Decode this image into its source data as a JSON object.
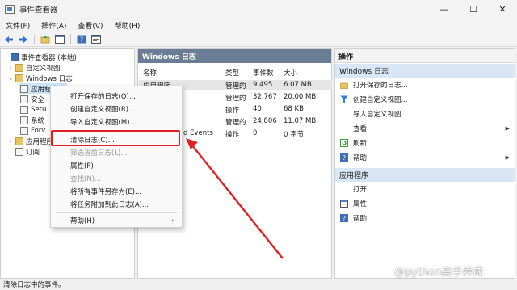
{
  "window": {
    "title": "事件查看器",
    "buttons": {
      "minimize": "—",
      "maximize": "☐",
      "close": "✕"
    }
  },
  "menubar": [
    "文件(F)",
    "操作(A)",
    "查看(V)",
    "帮助(H)"
  ],
  "tree": {
    "root": "事件查看器 (本地)",
    "custom_views": "自定义视图",
    "windows_logs": "Windows 日志",
    "children": [
      "应用程序",
      "安全",
      "Setu",
      "系统",
      "Forv"
    ],
    "app_service_logs": "应用程序",
    "subscriptions": "订阅"
  },
  "center": {
    "title": "Windows 日志",
    "columns": [
      "名称",
      "类型",
      "事件数",
      "大小"
    ],
    "rows": [
      {
        "name": "应用程序",
        "type": "管理的",
        "count": "9,495",
        "size": "6.07 MB"
      },
      {
        "name": "",
        "type": "管理的",
        "count": "32,767",
        "size": "20.00 MB"
      },
      {
        "name": "",
        "type": "操作",
        "count": "40",
        "size": "68 KB"
      },
      {
        "name": "",
        "type": "管理的",
        "count": "24,806",
        "size": "11.07 MB"
      },
      {
        "name": "d Events",
        "type": "操作",
        "count": "0",
        "size": "0 字节"
      }
    ]
  },
  "actions": {
    "title": "操作",
    "section1": "Windows 日志",
    "items1": [
      "打开保存的日志...",
      "创建自定义视图...",
      "导入自定义视图...",
      "查看",
      "刷新",
      "帮助"
    ],
    "section2": "应用程序",
    "items2": [
      "打开",
      "属性",
      "帮助"
    ]
  },
  "context_menu": {
    "items": [
      {
        "label": "打开保存的日志(O)...",
        "disabled": false
      },
      {
        "label": "创建自定义视图(R)...",
        "disabled": false
      },
      {
        "label": "导入自定义视图(M)...",
        "disabled": false
      },
      {
        "label": "清除日志(C)...",
        "disabled": false
      },
      {
        "label": "筛选当前日志(L)...",
        "disabled": true
      },
      {
        "label": "属性(P)",
        "disabled": false
      },
      {
        "label": "查找(N)...",
        "disabled": true
      },
      {
        "label": "将所有事件另存为(E)...",
        "disabled": false
      },
      {
        "label": "将任务附加到此日志(A)...",
        "disabled": false
      },
      {
        "label": "帮助(H)",
        "disabled": false
      }
    ]
  },
  "statusbar": "清除日志中的事件。",
  "watermark": "@python高手养成",
  "colors": {
    "highlight": "#e02020",
    "panel_header": "#6b7d95",
    "section": "#d9e6f5",
    "selection": "#cce4f7"
  }
}
